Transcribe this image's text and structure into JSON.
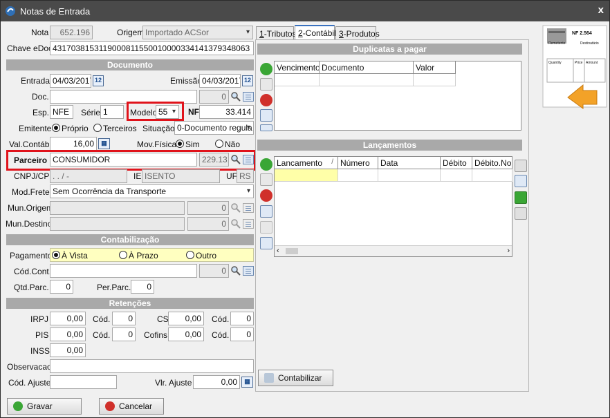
{
  "window": {
    "title": "Notas de Entrada",
    "close": "x"
  },
  "header": {
    "nota_label": "Nota",
    "nota_value": "652.196",
    "origem_label": "Origem",
    "origem_value": "Importado ACSor",
    "chave_label": "Chave eDoc",
    "chave_value": "43170381531190008115500100003341413793480​63"
  },
  "documento": {
    "section": "Documento",
    "entrada_label": "Entrada",
    "entrada_value": "04/03/2017",
    "emissao_label": "Emissão",
    "emissao_value": "04/03/2017",
    "doc_label": "Doc.",
    "doc_code": "0",
    "esp_label": "Esp.",
    "esp_value": "NFE",
    "serie_label": "Série",
    "serie_value": "1",
    "modelo_label": "Modelo",
    "modelo_value": "55",
    "nf_label": "NF",
    "nf_value": "33.414",
    "emitente_label": "Emitente",
    "emitente_opt1": "Próprio",
    "emitente_opt2": "Terceiros",
    "situacao_label": "Situação",
    "situacao_value": "0-Documento regula",
    "valcontabil_label": "Val.Contábil",
    "valcontabil_value": "16,00",
    "movfisica_label": "Mov.Física",
    "movfisica_opt1": "Sim",
    "movfisica_opt2": "Não",
    "parceiro_label": "Parceiro",
    "parceiro_value": "CONSUMIDOR",
    "parceiro_code": "229.131",
    "cnpj_label": "CNPJ/CPF",
    "cnpj_value": " .   .   /   -",
    "ie_label": "IE",
    "ie_value": "ISENTO",
    "uf_label": "UF",
    "uf_value": "RS",
    "modfrete_label": "Mod.Frete",
    "modfrete_value": "Sem Ocorrência da Transporte",
    "munorigem_label": "Mun.Origem",
    "munorigem_code": "0",
    "mundestino_label": "Mun.Destino",
    "mundestino_code": "0"
  },
  "contabilizacao": {
    "section": "Contabilização",
    "pagamento_label": "Pagamento",
    "opt_vista": "À Vista",
    "opt_prazo": "À Prazo",
    "opt_outro": "Outro",
    "codcont_label": "Cód.Cont.",
    "codcont_code": "0",
    "qtdparc_label": "Qtd.Parc.",
    "qtdparc_value": "0",
    "perparc_label": "Per.Parc.",
    "perparc_value": "0"
  },
  "retencoes": {
    "section": "Retenções",
    "irpj_label": "IRPJ",
    "irpj_value": "0,00",
    "irpj_cod_label": "Cód.",
    "irpj_cod": "0",
    "cs_label": "CS",
    "cs_value": "0,00",
    "cs_cod_label": "Cód.",
    "cs_cod": "0",
    "pis_label": "PIS",
    "pis_value": "0,00",
    "pis_cod_label": "Cód.",
    "pis_cod": "0",
    "cofins_label": "Cofins",
    "cofins_value": "0,00",
    "cofins_cod_label": "Cód.",
    "cofins_cod": "0",
    "inss_label": "INSS",
    "inss_value": "0,00",
    "obs_label": "Observacao",
    "codajuste_label": "Cód. Ajuste",
    "vlrajuste_label": "Vlr. Ajuste",
    "vlrajuste_value": "0,00"
  },
  "buttons": {
    "gravar": "Gravar",
    "cancelar": "Cancelar",
    "contabilizar": "Contabilizar"
  },
  "tabs": [
    {
      "key": "1",
      "label": "-Tributos"
    },
    {
      "key": "2",
      "label": "-Contábil"
    },
    {
      "key": "3",
      "label": "-Produtos"
    }
  ],
  "duplicatas": {
    "section": "Duplicatas a pagar",
    "columns": [
      "Vencimento",
      "Documento",
      "Valor"
    ]
  },
  "lancamentos": {
    "section": "Lançamentos",
    "columns": [
      "Lancamento",
      "Número",
      "Data",
      "Débito",
      "Débito.Nom"
    ],
    "sort_marker": "/"
  },
  "nf_image": {
    "title": "NF 2.564",
    "remetente": "Remetente",
    "destinatario": "Destinatário",
    "quantity": "Quantity",
    "price": "Price",
    "amount": "Amount"
  },
  "colors": {
    "accent_red": "#e0131b",
    "band": "#a9a9a9",
    "highlight": "#ffffc0"
  }
}
